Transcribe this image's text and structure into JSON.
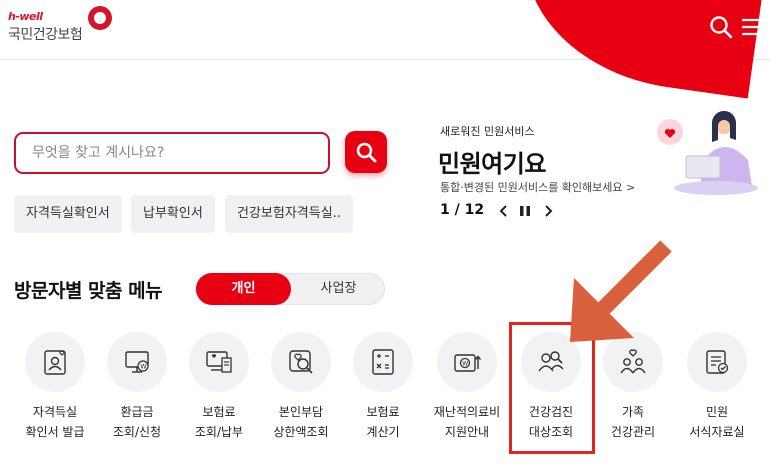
{
  "header": {
    "logo_brand": "h-well",
    "logo_name": "국민건강보험"
  },
  "search": {
    "placeholder": "무엇을 찾고 계시나요?"
  },
  "quick_links": [
    "자격득실확인서",
    "납부확인서",
    "건강보험자격득실.."
  ],
  "notice": {
    "tag": "새로워진 민원서비스",
    "title": "민원여기요",
    "subtitle": "통합·변경된 민원서비스를 확인해보세요 >",
    "pager": "1 / 12"
  },
  "section": {
    "title": "방문자별 맞춤 메뉴",
    "toggle": {
      "on": "개인",
      "off": "사업장"
    }
  },
  "menu": [
    {
      "line1": "자격득실",
      "line2": "확인서 발급",
      "icon": "id-card-heart-icon"
    },
    {
      "line1": "환급금",
      "line2": "조회/신청",
      "icon": "monitor-won-icon"
    },
    {
      "line1": "보험료",
      "line2": "조회/납부",
      "icon": "computer-receipt-icon"
    },
    {
      "line1": "본인부담",
      "line2": "상한액조회",
      "icon": "heart-search-icon"
    },
    {
      "line1": "보험료",
      "line2": "계산기",
      "icon": "calculator-icon"
    },
    {
      "line1": "재난적의료비",
      "line2": "지원안내",
      "icon": "money-support-icon"
    },
    {
      "line1": "건강검진",
      "line2": "대상조회",
      "icon": "people-search-icon"
    },
    {
      "line1": "가족",
      "line2": "건강관리",
      "icon": "family-heart-icon"
    },
    {
      "line1": "민원",
      "line2": "서식자료실",
      "icon": "document-form-icon"
    }
  ],
  "colors": {
    "brand_red": "#e60012",
    "highlight": "#e1251b",
    "arrow": "#d9603c"
  }
}
